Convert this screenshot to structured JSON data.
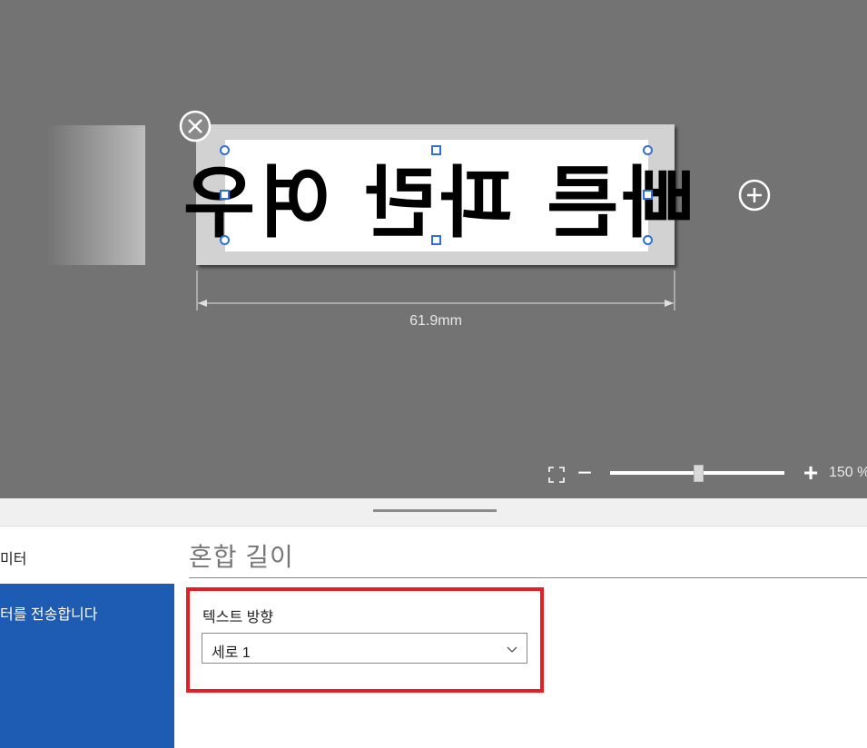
{
  "canvas": {
    "label_text": "빠른 파란 여우",
    "label_orientation": "mirrored",
    "width_dimension": "61.9mm",
    "zoom_value": "150 %",
    "zoom_fraction": 0.5
  },
  "sidebar": {
    "items": [
      {
        "label": "미터"
      },
      {
        "label": "터를 전송합니다"
      }
    ]
  },
  "panel": {
    "section_title": "혼합 길이",
    "text_direction_label": "텍스트 방향",
    "text_direction_value": "세로 1"
  },
  "colors": {
    "canvas_bg": "#737373",
    "accent_blue": "#1e5bb3",
    "highlight_red": "#e61e24",
    "handle_blue": "#2f6fd6"
  },
  "icons": [
    "close-circle-icon",
    "add-circle-icon",
    "fit-to-screen-icon",
    "zoom-out-icon",
    "zoom-in-icon",
    "chevron-down-icon"
  ]
}
